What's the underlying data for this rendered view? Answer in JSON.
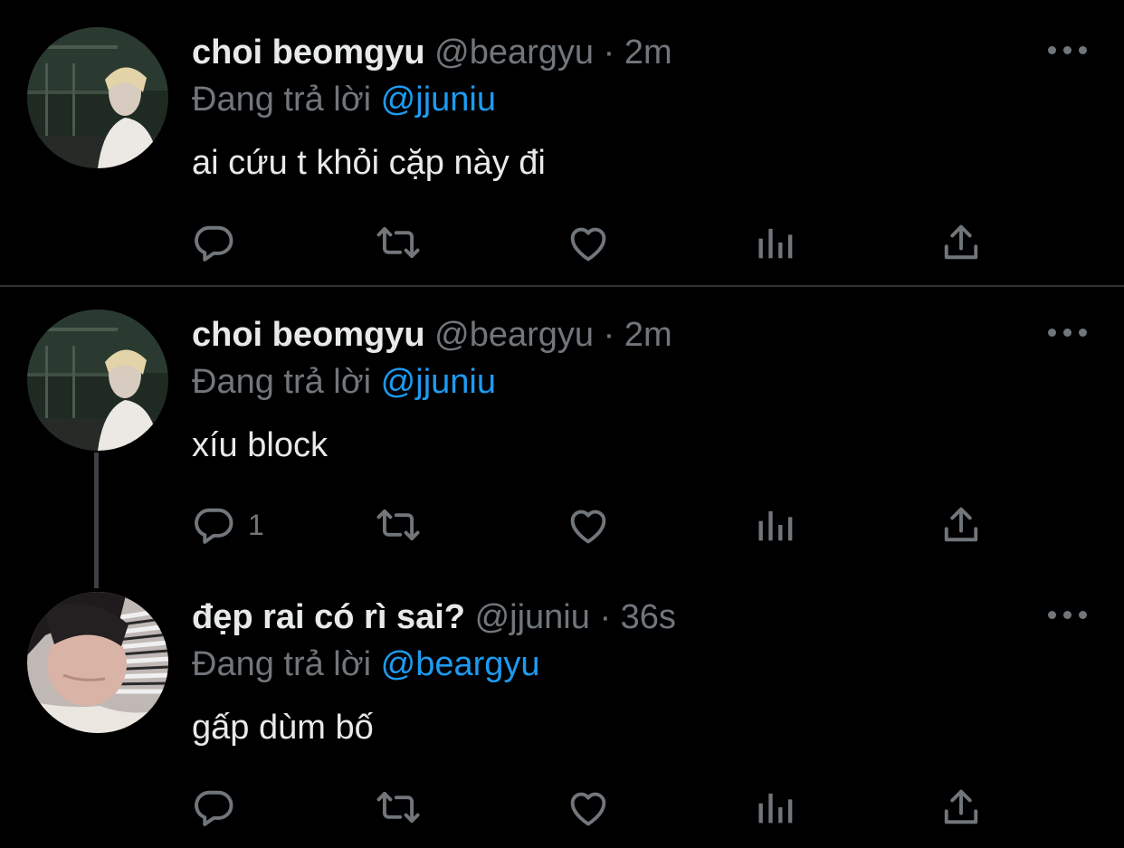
{
  "tweets": [
    {
      "author": {
        "name": "choi beomgyu",
        "handle": "@beargyu"
      },
      "separator": "·",
      "time": "2m",
      "replying_prefix": "Đang trả lời",
      "replying_to": "@jjuniu",
      "text": "ai cứu t khỏi cặp này đi",
      "reply_count": ""
    },
    {
      "author": {
        "name": "choi beomgyu",
        "handle": "@beargyu"
      },
      "separator": "·",
      "time": "2m",
      "replying_prefix": "Đang trả lời",
      "replying_to": "@jjuniu",
      "text": "xíu block",
      "reply_count": "1"
    },
    {
      "author": {
        "name": "đẹp rai có rì sai?",
        "handle": "@jjuniu"
      },
      "separator": "·",
      "time": "36s",
      "replying_prefix": "Đang trả lời",
      "replying_to": "@beargyu",
      "text": "gấp dùm bố",
      "reply_count": ""
    }
  ],
  "colors": {
    "background": "#000000",
    "text": "#e7e9ea",
    "muted": "#71767b",
    "accent": "#1d9bf0",
    "divider": "#2f3336"
  },
  "icons": [
    "reply-icon",
    "retweet-icon",
    "like-icon",
    "analytics-icon",
    "share-icon",
    "more-icon"
  ]
}
